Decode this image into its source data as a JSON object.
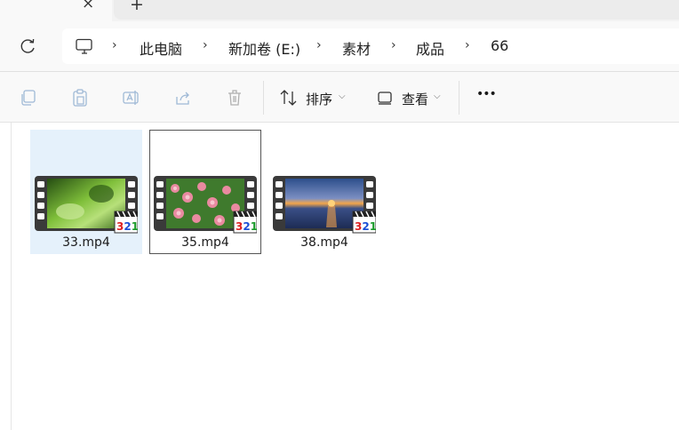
{
  "tabs": {
    "close_glyph": "×",
    "new_tab_glyph": "+"
  },
  "breadcrumb": [
    {
      "label": "此电脑"
    },
    {
      "label": "新加卷 (E:)"
    },
    {
      "label": "素材"
    },
    {
      "label": "成品"
    },
    {
      "label": "66"
    }
  ],
  "toolbar": {
    "sort_label": "排序",
    "view_label": "查看",
    "more_glyph": "•••"
  },
  "files": [
    {
      "name": "33.mp4",
      "state": "selected"
    },
    {
      "name": "35.mp4",
      "state": "focused"
    },
    {
      "name": "38.mp4",
      "state": "normal"
    }
  ],
  "icons": {
    "refresh": "refresh-icon",
    "pc": "pc-icon",
    "copy": "copy-icon",
    "paste": "paste-icon",
    "rename": "rename-icon",
    "share": "share-icon",
    "delete": "delete-icon",
    "sort": "sort-icon",
    "view": "view-icon",
    "badge": "mpc-badge-icon"
  },
  "colors": {
    "selection": "#e5f1fb",
    "accent": "#0067c0"
  }
}
